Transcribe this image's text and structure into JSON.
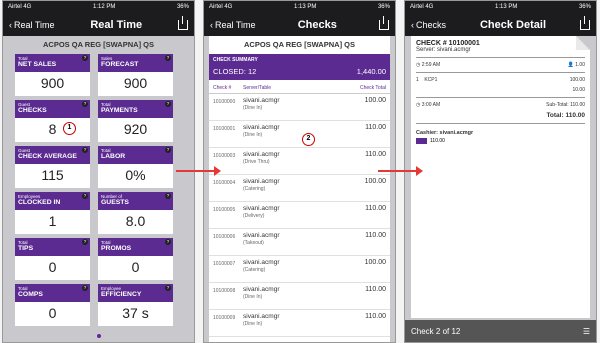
{
  "status": {
    "carrier": "Airtel",
    "network": "4G",
    "screens": [
      {
        "time": "1:12 PM",
        "battery": "36%"
      },
      {
        "time": "1:13 PM",
        "battery": "36%"
      },
      {
        "time": "1:13 PM",
        "battery": "36%"
      }
    ]
  },
  "screen1": {
    "back": "Real Time",
    "title": "Real Time",
    "store": "ACPOS QA REG [SWAPNA] QS",
    "tiles": [
      {
        "sub": "Total",
        "label": "NET SALES",
        "value": "900"
      },
      {
        "sub": "Sales",
        "label": "FORECAST",
        "value": "900"
      },
      {
        "sub": "Guest",
        "label": "CHECKS",
        "value": "8"
      },
      {
        "sub": "Total",
        "label": "PAYMENTS",
        "value": "920"
      },
      {
        "sub": "Guest",
        "label": "CHECK AVERAGE",
        "value": "115"
      },
      {
        "sub": "Total",
        "label": "LABOR",
        "value": "0%"
      },
      {
        "sub": "Employees",
        "label": "CLOCKED IN",
        "value": "1"
      },
      {
        "sub": "Number of",
        "label": "GUESTS",
        "value": "8.0"
      },
      {
        "sub": "Total",
        "label": "TIPS",
        "value": "0"
      },
      {
        "sub": "Total",
        "label": "PROMOS",
        "value": "0"
      },
      {
        "sub": "Total",
        "label": "COMPS",
        "value": "0"
      },
      {
        "sub": "Employee",
        "label": "EFFICIENCY",
        "value": "37 s"
      }
    ],
    "help": "?",
    "badge": "1"
  },
  "screen2": {
    "back": "Real Time",
    "title": "Checks",
    "store": "ACPOS QA REG [SWAPNA] QS",
    "summary_title": "CHECK SUMMARY",
    "closed": "CLOSED: 12",
    "closed_total": "1,440.00",
    "col_check": "Check #",
    "col_server": "Server/Table",
    "col_total": "Check Total",
    "badge": "2",
    "rows": [
      {
        "num": "10100000",
        "server": "sivani.acmgr",
        "type": "(Dine In)",
        "total": "100.00"
      },
      {
        "num": "10100001",
        "server": "sivani.acmgr",
        "type": "(Dine In)",
        "total": "110.00"
      },
      {
        "num": "10100003",
        "server": "sivani.acmgr",
        "type": "(Drive Thru)",
        "total": "110.00"
      },
      {
        "num": "10100004",
        "server": "sivani.acmgr",
        "type": "(Catering)",
        "total": "100.00"
      },
      {
        "num": "10100005",
        "server": "sivani.acmgr",
        "type": "(Delivery)",
        "total": "110.00"
      },
      {
        "num": "10100006",
        "server": "sivani.acmgr",
        "type": "(Takeout)",
        "total": "110.00"
      },
      {
        "num": "10100007",
        "server": "sivani.acmgr",
        "type": "(Catering)",
        "total": "100.00"
      },
      {
        "num": "10100008",
        "server": "sivani.acmgr",
        "type": "(Dine In)",
        "total": "110.00"
      },
      {
        "num": "10100009",
        "server": "sivani.acmgr",
        "type": "(Dine In)",
        "total": "110.00"
      }
    ]
  },
  "screen3": {
    "back": "Checks",
    "title": "Check Detail",
    "check_no": "CHECK # 10100001",
    "server": "Server: sivani.acmgr",
    "time1": "2:59 AM",
    "guests": "1.00",
    "item_qty": "1",
    "item_name": "KCP1",
    "item_price": "100.00",
    "item_tax": "10.00",
    "time2": "3:00 AM",
    "subtotal_label": "Sub-Total:",
    "subtotal": "110.00",
    "total_label": "Total:",
    "total": "110.00",
    "cashier": "Cashier: sivani.acmgr",
    "payment": "110.00",
    "footer": "Check 2 of 12"
  }
}
